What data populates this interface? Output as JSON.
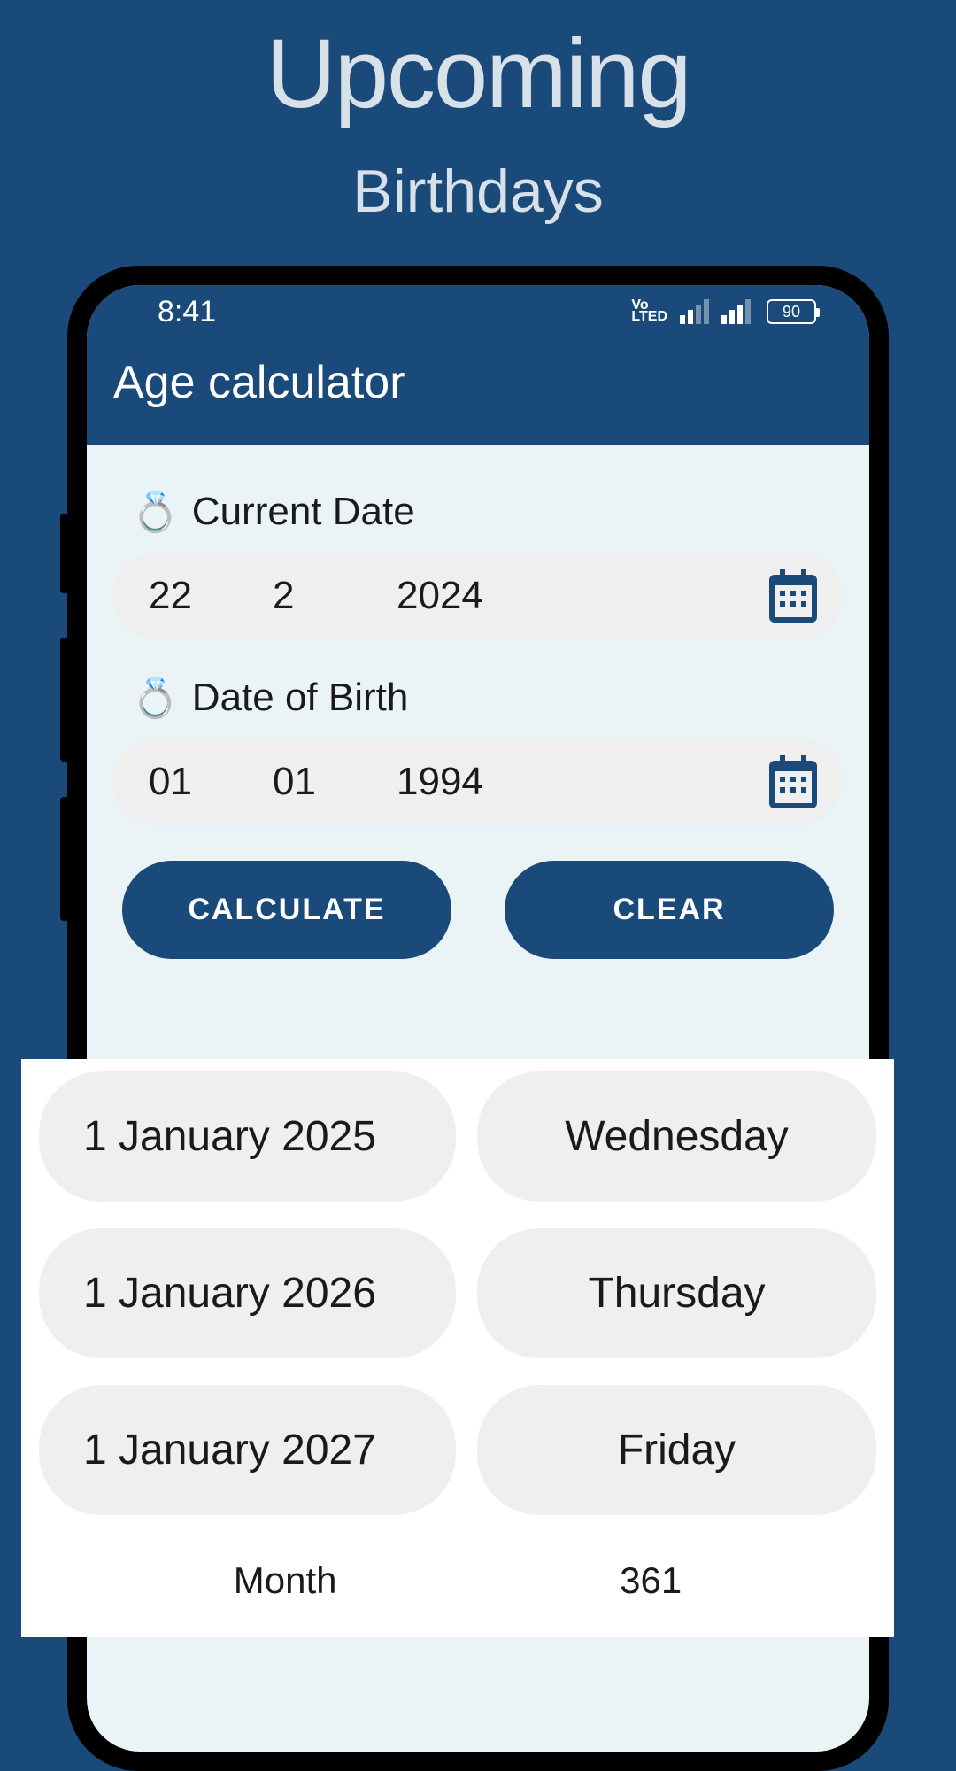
{
  "promo": {
    "title": "Upcoming",
    "subtitle": "Birthdays"
  },
  "status": {
    "time": "8:41",
    "battery": "90"
  },
  "app": {
    "title": "Age calculator"
  },
  "fields": {
    "current": {
      "label": "Current Date",
      "day": "22",
      "month": "2",
      "year": "2024"
    },
    "dob": {
      "label": "Date of Birth",
      "day": "01",
      "month": "01",
      "year": "1994"
    }
  },
  "buttons": {
    "calculate": "CALCULATE",
    "clear": "CLEAR"
  },
  "upcoming": [
    {
      "date": "1 January 2025",
      "day": "Wednesday"
    },
    {
      "date": "1 January 2026",
      "day": "Thursday"
    },
    {
      "date": "1 January 2027",
      "day": "Friday"
    }
  ],
  "bottom": {
    "label": "Month",
    "value": "361"
  }
}
